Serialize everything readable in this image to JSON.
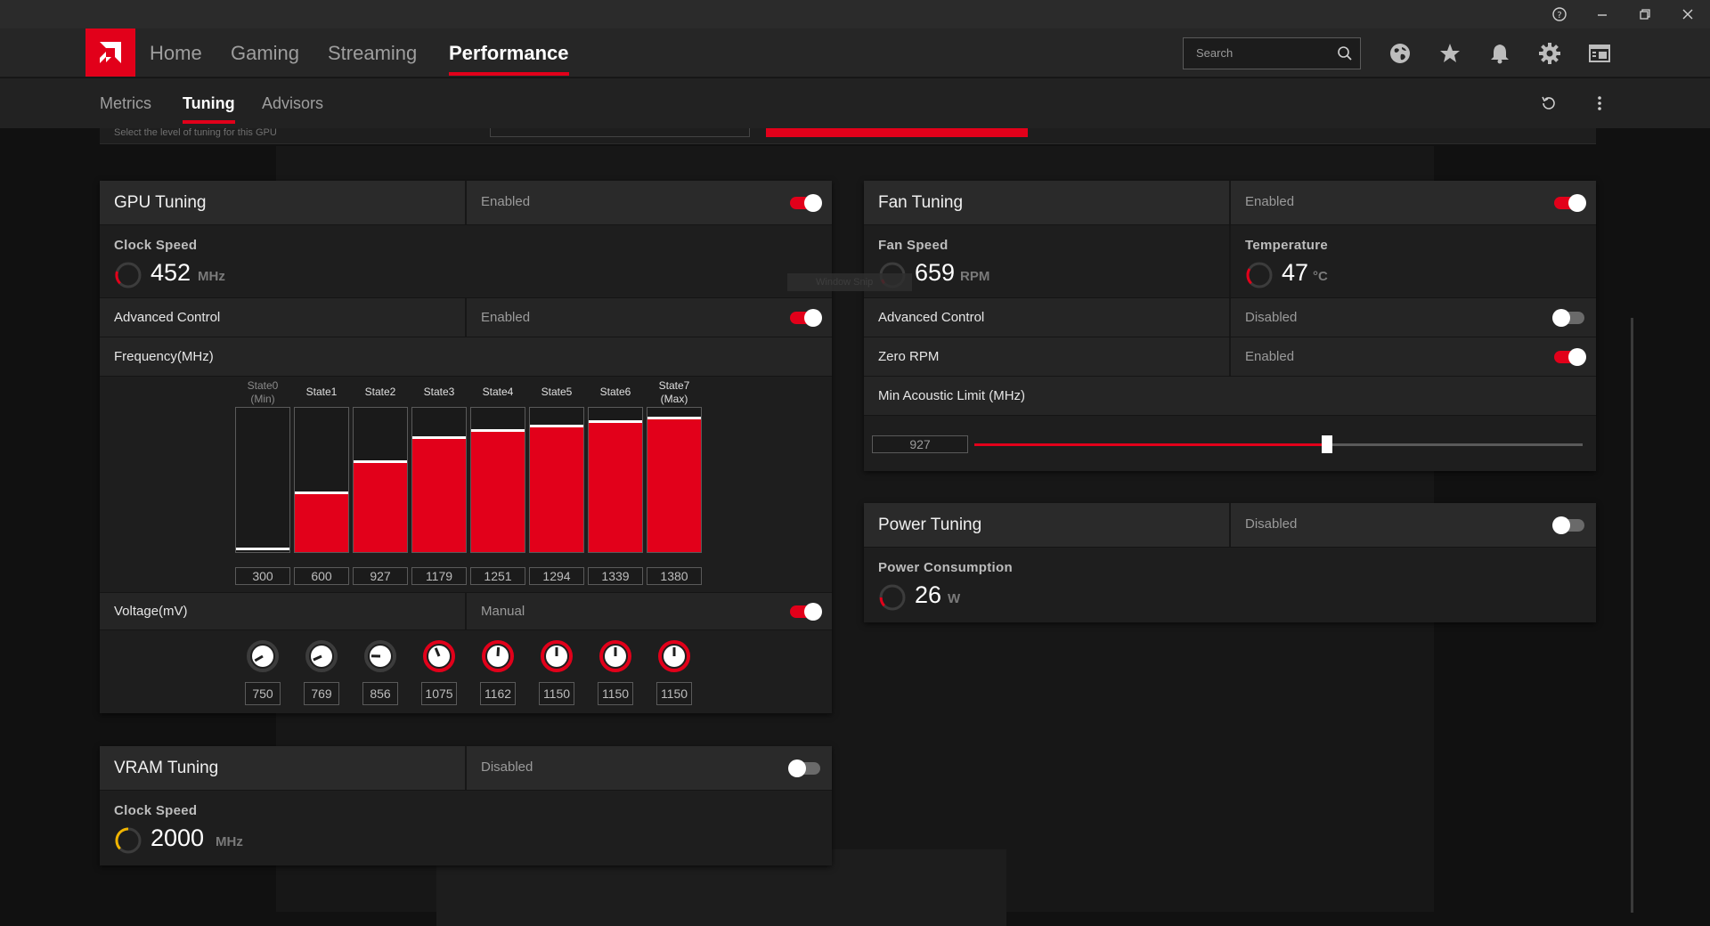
{
  "titlebar": {
    "help_icon": "help-circle-icon",
    "minimize_icon": "minimize-icon",
    "restore_icon": "restore-icon",
    "close_icon": "close-icon"
  },
  "nav": {
    "tabs": [
      {
        "label": "Home"
      },
      {
        "label": "Gaming"
      },
      {
        "label": "Streaming"
      },
      {
        "label": "Performance",
        "active": true
      }
    ],
    "search_placeholder": "Search",
    "icons": [
      "globe-icon",
      "star-icon",
      "bell-icon",
      "gear-icon",
      "layout-icon"
    ]
  },
  "subnav": {
    "tabs": [
      {
        "label": "Metrics"
      },
      {
        "label": "Tuning",
        "active": true
      },
      {
        "label": "Advisors"
      }
    ],
    "icons": [
      "reset-icon",
      "more-vertical-icon"
    ]
  },
  "top_strip": {
    "text": "Select the level of tuning for this GPU"
  },
  "gpu_tuning": {
    "title": "GPU Tuning",
    "state": "Enabled",
    "enabled": true,
    "clock_label": "Clock Speed",
    "clock_value": "452",
    "clock_unit": "MHz",
    "advanced_label": "Advanced Control",
    "advanced_state": "Enabled",
    "advanced_enabled": true,
    "frequency_label": "Frequency(MHz)",
    "voltage_label": "Voltage(mV)",
    "voltage_state": "Manual",
    "voltage_enabled": true,
    "states": [
      {
        "label": "State0 (Min)",
        "freq": "300",
        "volt": "750"
      },
      {
        "label": "State1",
        "freq": "600",
        "volt": "769"
      },
      {
        "label": "State2",
        "freq": "927",
        "volt": "856"
      },
      {
        "label": "State3",
        "freq": "1179",
        "volt": "1075"
      },
      {
        "label": "State4",
        "freq": "1251",
        "volt": "1162"
      },
      {
        "label": "State5",
        "freq": "1294",
        "volt": "1150"
      },
      {
        "label": "State6",
        "freq": "1339",
        "volt": "1150"
      },
      {
        "label": "State7 (Max)",
        "freq": "1380",
        "volt": "1150"
      }
    ]
  },
  "vram_tuning": {
    "title": "VRAM Tuning",
    "state": "Disabled",
    "enabled": false,
    "clock_label": "Clock Speed",
    "clock_value": "2000",
    "clock_unit": "MHz"
  },
  "fan_tuning": {
    "title": "Fan Tuning",
    "state": "Enabled",
    "enabled": true,
    "speed_label": "Fan Speed",
    "speed_value": "659",
    "speed_unit": "RPM",
    "temp_label": "Temperature",
    "temp_value": "47",
    "temp_unit": "°C",
    "advanced_label": "Advanced Control",
    "advanced_state": "Disabled",
    "advanced_enabled": false,
    "zero_rpm_label": "Zero RPM",
    "zero_rpm_state": "Enabled",
    "zero_rpm_enabled": true,
    "acoustic_label": "Min Acoustic Limit (MHz)",
    "acoustic_value": "927",
    "acoustic_fraction": 0.58
  },
  "power_tuning": {
    "title": "Power Tuning",
    "state": "Disabled",
    "enabled": false,
    "consumption_label": "Power Consumption",
    "consumption_value": "26",
    "consumption_unit": "W"
  },
  "tooltip": {
    "text": "Window Snip"
  },
  "colors": {
    "accent": "#e2001a",
    "gauge_yellow": "#f0b400"
  }
}
